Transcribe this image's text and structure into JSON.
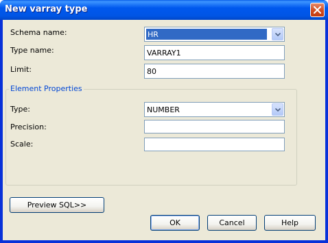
{
  "window": {
    "title": "New varray type"
  },
  "form": {
    "schema_label": "Schema name:",
    "schema_value": "HR",
    "type_name_label": "Type name:",
    "type_name_value": "VARRAY1",
    "limit_label": "Limit:",
    "limit_value": "80"
  },
  "element_properties": {
    "title": "Element Properties",
    "type_label": "Type:",
    "type_value": "NUMBER",
    "precision_label": "Precision:",
    "precision_value": "",
    "scale_label": "Scale:",
    "scale_value": ""
  },
  "buttons": {
    "preview_sql": "Preview SQL>>",
    "ok": "OK",
    "cancel": "Cancel",
    "help": "Help"
  },
  "icons": {
    "close": "close-icon",
    "dropdown": "chevron-down-icon"
  }
}
